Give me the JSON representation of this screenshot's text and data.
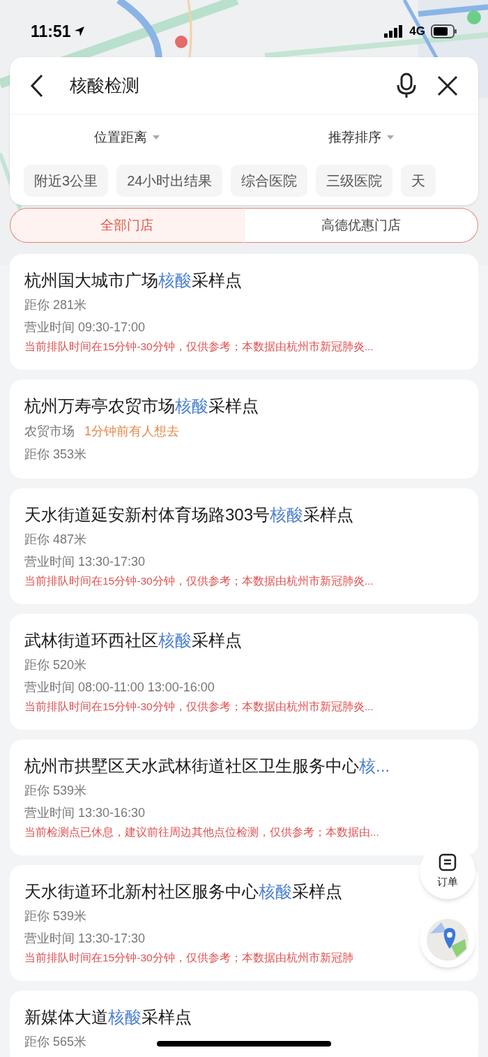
{
  "status_bar": {
    "time": "11:51",
    "network": "4G"
  },
  "search": {
    "value": "核酸检测"
  },
  "sort_filters": [
    {
      "label": "位置距离"
    },
    {
      "label": "推荐排序"
    }
  ],
  "chips": [
    "附近3公里",
    "24小时出结果",
    "综合医院",
    "三级医院",
    "天"
  ],
  "tabs": [
    {
      "label": "全部门店",
      "selected": true
    },
    {
      "label": "高德优惠门店",
      "selected": false
    }
  ],
  "results": [
    {
      "title": [
        {
          "text": "杭州国大城市广场",
          "highlight": false
        },
        {
          "text": "核酸",
          "highlight": true
        },
        {
          "text": "采样点",
          "highlight": false
        }
      ],
      "lines": [
        {
          "kind": "meta",
          "text": "距你 281米"
        },
        {
          "kind": "meta",
          "text": "营业时间 09:30-17:00"
        },
        {
          "kind": "notice",
          "text": "当前排队时间在15分钟-30分钟，仅供参考；本数据由杭州市新冠肺炎..."
        }
      ]
    },
    {
      "title": [
        {
          "text": "杭州万寿亭农贸市场",
          "highlight": false
        },
        {
          "text": "核酸",
          "highlight": true
        },
        {
          "text": "采样点",
          "highlight": false
        }
      ],
      "lines": [
        {
          "kind": "category",
          "text": "农贸市场",
          "extra": "1分钟前有人想去"
        },
        {
          "kind": "meta",
          "text": "距你 353米"
        }
      ]
    },
    {
      "title": [
        {
          "text": "天水街道延安新村体育场路303号",
          "highlight": false
        },
        {
          "text": "核酸",
          "highlight": true
        },
        {
          "text": "采样点",
          "highlight": false
        }
      ],
      "lines": [
        {
          "kind": "meta",
          "text": "距你 487米"
        },
        {
          "kind": "meta",
          "text": "营业时间 13:30-17:30"
        },
        {
          "kind": "notice",
          "text": "当前排队时间在15分钟-30分钟，仅供参考；本数据由杭州市新冠肺炎..."
        }
      ]
    },
    {
      "title": [
        {
          "text": "武林街道环西社区",
          "highlight": false
        },
        {
          "text": "核酸",
          "highlight": true
        },
        {
          "text": "采样点",
          "highlight": false
        }
      ],
      "lines": [
        {
          "kind": "meta",
          "text": "距你 520米"
        },
        {
          "kind": "meta",
          "text": "营业时间 08:00-11:00 13:00-16:00"
        },
        {
          "kind": "notice",
          "text": "当前排队时间在15分钟-30分钟，仅供参考；本数据由杭州市新冠肺炎..."
        }
      ]
    },
    {
      "title": [
        {
          "text": "杭州市拱墅区天水武林街道社区卫生服务中心",
          "highlight": false
        },
        {
          "text": "核...",
          "highlight": true
        }
      ],
      "lines": [
        {
          "kind": "meta",
          "text": "距你 539米"
        },
        {
          "kind": "meta",
          "text": "营业时间 13:30-16:30"
        },
        {
          "kind": "notice",
          "text": "当前检测点已休息，建议前往周边其他点位检测，仅供参考；本数据由..."
        }
      ]
    },
    {
      "title": [
        {
          "text": "天水街道环北新村社区服务中心",
          "highlight": false
        },
        {
          "text": "核酸",
          "highlight": true
        },
        {
          "text": "采样点",
          "highlight": false
        }
      ],
      "lines": [
        {
          "kind": "meta",
          "text": "距你 539米"
        },
        {
          "kind": "meta",
          "text": "营业时间 13:30-17:30"
        },
        {
          "kind": "notice",
          "text": "当前排队时间在15分钟-30分钟，仅供参考；本数据由杭州市新冠肺"
        }
      ]
    },
    {
      "title": [
        {
          "text": "新媒体大道",
          "highlight": false
        },
        {
          "text": "核酸",
          "highlight": true
        },
        {
          "text": "采样点",
          "highlight": false
        }
      ],
      "lines": [
        {
          "kind": "meta",
          "text": "距你 565米"
        }
      ]
    }
  ],
  "order_button": {
    "label": "订单"
  }
}
